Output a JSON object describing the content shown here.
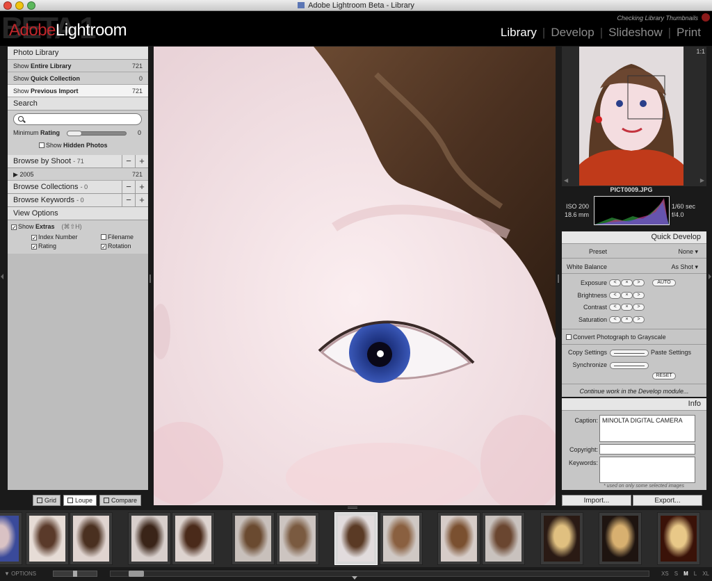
{
  "window": {
    "title": "Adobe Lightroom Beta - Library"
  },
  "header": {
    "beta_mark": "BETA 1",
    "logo_adobe": "Adobe",
    "logo_lightroom": "Lightroom",
    "status": "Checking Library Thumbnails",
    "modules": [
      "Library",
      "Develop",
      "Slideshow",
      "Print"
    ],
    "active_module": "Library"
  },
  "library": {
    "title": "Photo Library",
    "items": [
      {
        "prefix": "Show ",
        "bold": "Entire Library",
        "count": "721"
      },
      {
        "prefix": "Show ",
        "bold": "Quick Collection",
        "count": "0"
      },
      {
        "prefix": "Show ",
        "bold": "Previous Import",
        "count": "721"
      }
    ]
  },
  "search": {
    "title": "Search",
    "min_rating_label": "Minimum",
    "min_rating_bold": "Rating",
    "min_rating_value": "0",
    "show_hidden_prefix": "Show ",
    "show_hidden_bold": "Hidden Photos",
    "rating_level": 0
  },
  "browse_shoot": {
    "title": "Browse by Shoot",
    "count": "- 71",
    "rows": [
      {
        "label": "2005",
        "count": "721"
      }
    ]
  },
  "browse_collections": {
    "title": "Browse Collections",
    "count": "- 0"
  },
  "browse_keywords": {
    "title": "Browse Keywords",
    "count": "- 0"
  },
  "view_options": {
    "title": "View Options",
    "show_extras_prefix": "Show ",
    "show_extras_bold": "Extras",
    "shortcut": "(⌘⇧H)",
    "index_number": "Index Number",
    "filename": "Filename",
    "rating": "Rating",
    "rotation": "Rotation"
  },
  "view_buttons": {
    "grid": "Grid",
    "loupe": "Loupe",
    "compare": "Compare"
  },
  "navigator": {
    "ratio": "1:1",
    "filename": "PICT0009.JPG"
  },
  "exif": {
    "iso": "ISO 200",
    "focal": "18.6 mm",
    "shutter": "1/60 sec",
    "aperture": "f/4.0"
  },
  "quick_develop": {
    "title": "Quick Develop",
    "preset_label": "Preset",
    "preset_value": "None ▾",
    "wb_label": "White Balance",
    "wb_value": "As Shot ▾",
    "exposure": "Exposure",
    "brightness": "Brightness",
    "contrast": "Contrast",
    "saturation": "Saturation",
    "auto": "AUTO",
    "grayscale": "Convert Photograph to Grayscale",
    "copy_settings": "Copy Settings",
    "paste_settings": "Paste Settings",
    "synchronize": "Synchronize",
    "reset": "RESET",
    "continue": "Continue work in the Develop module..."
  },
  "info": {
    "title": "Info",
    "caption_label": "Caption:",
    "caption_value": "MINOLTA DIGITAL CAMERA",
    "copyright_label": "Copyright:",
    "keywords_label": "Keywords:",
    "note": "* used on only some selected images"
  },
  "io": {
    "import": "Import...",
    "export": "Export..."
  },
  "bottom": {
    "options": "OPTIONS",
    "sizes": [
      "XS",
      "S",
      "M",
      "L",
      "XL"
    ],
    "active_size": "M"
  },
  "colors": {
    "accent_red": "#c0262b",
    "panel": "#bdbdbd"
  }
}
